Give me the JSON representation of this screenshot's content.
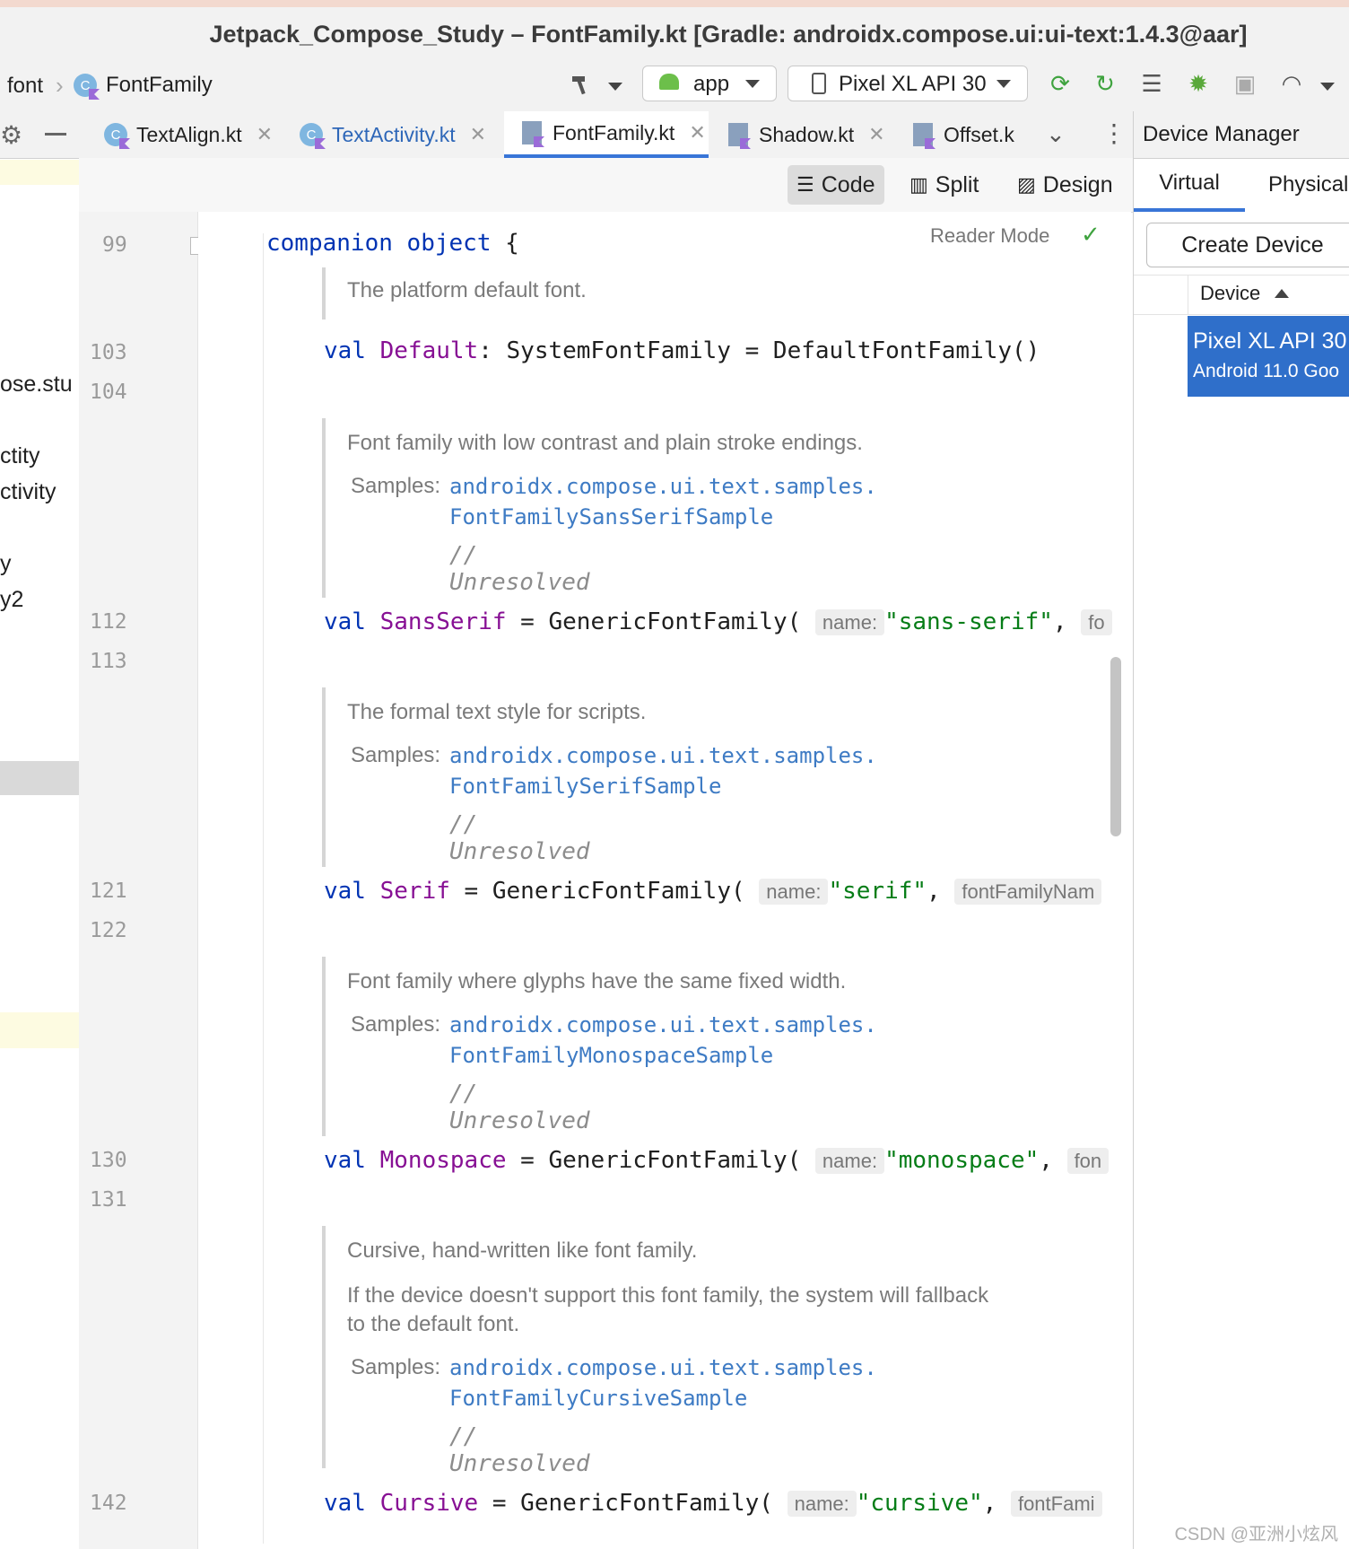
{
  "window": {
    "title": "Jetpack_Compose_Study – FontFamily.kt [Gradle: androidx.compose.ui:ui-text:1.4.3@aar]"
  },
  "breadcrumb": {
    "items": [
      "font",
      "FontFamily"
    ]
  },
  "toolbar": {
    "run_config": "app",
    "device": "Pixel XL API 30"
  },
  "left_panel": {
    "fragments": [
      "ose.stu",
      "ctity",
      "ctivity",
      "y",
      "y2"
    ]
  },
  "tabs": [
    {
      "label": "TextAlign.kt"
    },
    {
      "label": "TextActivity.kt"
    },
    {
      "label": "FontFamily.kt",
      "active": true
    },
    {
      "label": "Shadow.kt"
    },
    {
      "label": "Offset.k"
    }
  ],
  "view_modes": {
    "code": "Code",
    "split": "Split",
    "design": "Design"
  },
  "editor": {
    "reader_mode": "Reader Mode",
    "line_numbers": [
      "99",
      "103",
      "104",
      "112",
      "113",
      "121",
      "122",
      "130",
      "131",
      "142"
    ],
    "companion": {
      "kw1": "companion",
      "kw2": "object",
      "brace": "{"
    },
    "docs": {
      "default": "The platform default font.",
      "sans": "Font family with low contrast and plain stroke endings.",
      "serif": "The formal text style for scripts.",
      "mono": "Font family where glyphs have the same fixed width.",
      "cursive1": "Cursive, hand-written like font family.",
      "cursive2a": "If the device doesn't support this font family, the system will fallback",
      "cursive2b": "to the default font."
    },
    "samples_label": "Samples:",
    "samples_pkg": "androidx.compose.ui.text.samples.",
    "samples": {
      "sans": "FontFamilySansSerifSample",
      "serif": "FontFamilySerifSample",
      "mono": "FontFamilyMonospaceSample",
      "cursive": "FontFamilyCursiveSample"
    },
    "unresolved": "// Unresolved",
    "val_kw": "val",
    "fn": "GenericFontFamily(",
    "name_hint": "name:",
    "default_line": {
      "prop": "Default",
      "rest": ": SystemFontFamily = DefaultFontFamily()"
    },
    "sans_line": {
      "prop": "SansSerif",
      "eq": " = ",
      "str": "\"sans-serif\"",
      "comma": ",",
      "hint2": "fo"
    },
    "serif_line": {
      "prop": "Serif",
      "eq": " = ",
      "str": "\"serif\"",
      "comma": ",",
      "hint2": "fontFamilyNam"
    },
    "mono_line": {
      "prop": "Monospace",
      "eq": " = ",
      "str": "\"monospace\"",
      "comma": ",",
      "hint2": "fon"
    },
    "cursive_line": {
      "prop": "Cursive",
      "eq": " = ",
      "str": "\"cursive\"",
      "comma": ",",
      "hint2": "fontFami"
    }
  },
  "device_manager": {
    "title": "Device Manager",
    "tabs": [
      "Virtual",
      "Physical"
    ],
    "create_button": "Create Device",
    "column_header": "Device",
    "device_name": "Pixel XL API 30",
    "device_sub": "Android 11.0 Goo"
  },
  "watermark": "CSDN @亚洲小炫风",
  "colors": {
    "accent": "#3875d7",
    "keyword": "#0033b3",
    "property": "#871094",
    "string": "#067d17",
    "doc_link": "#3e7bc4",
    "selection": "#2f6fca"
  }
}
